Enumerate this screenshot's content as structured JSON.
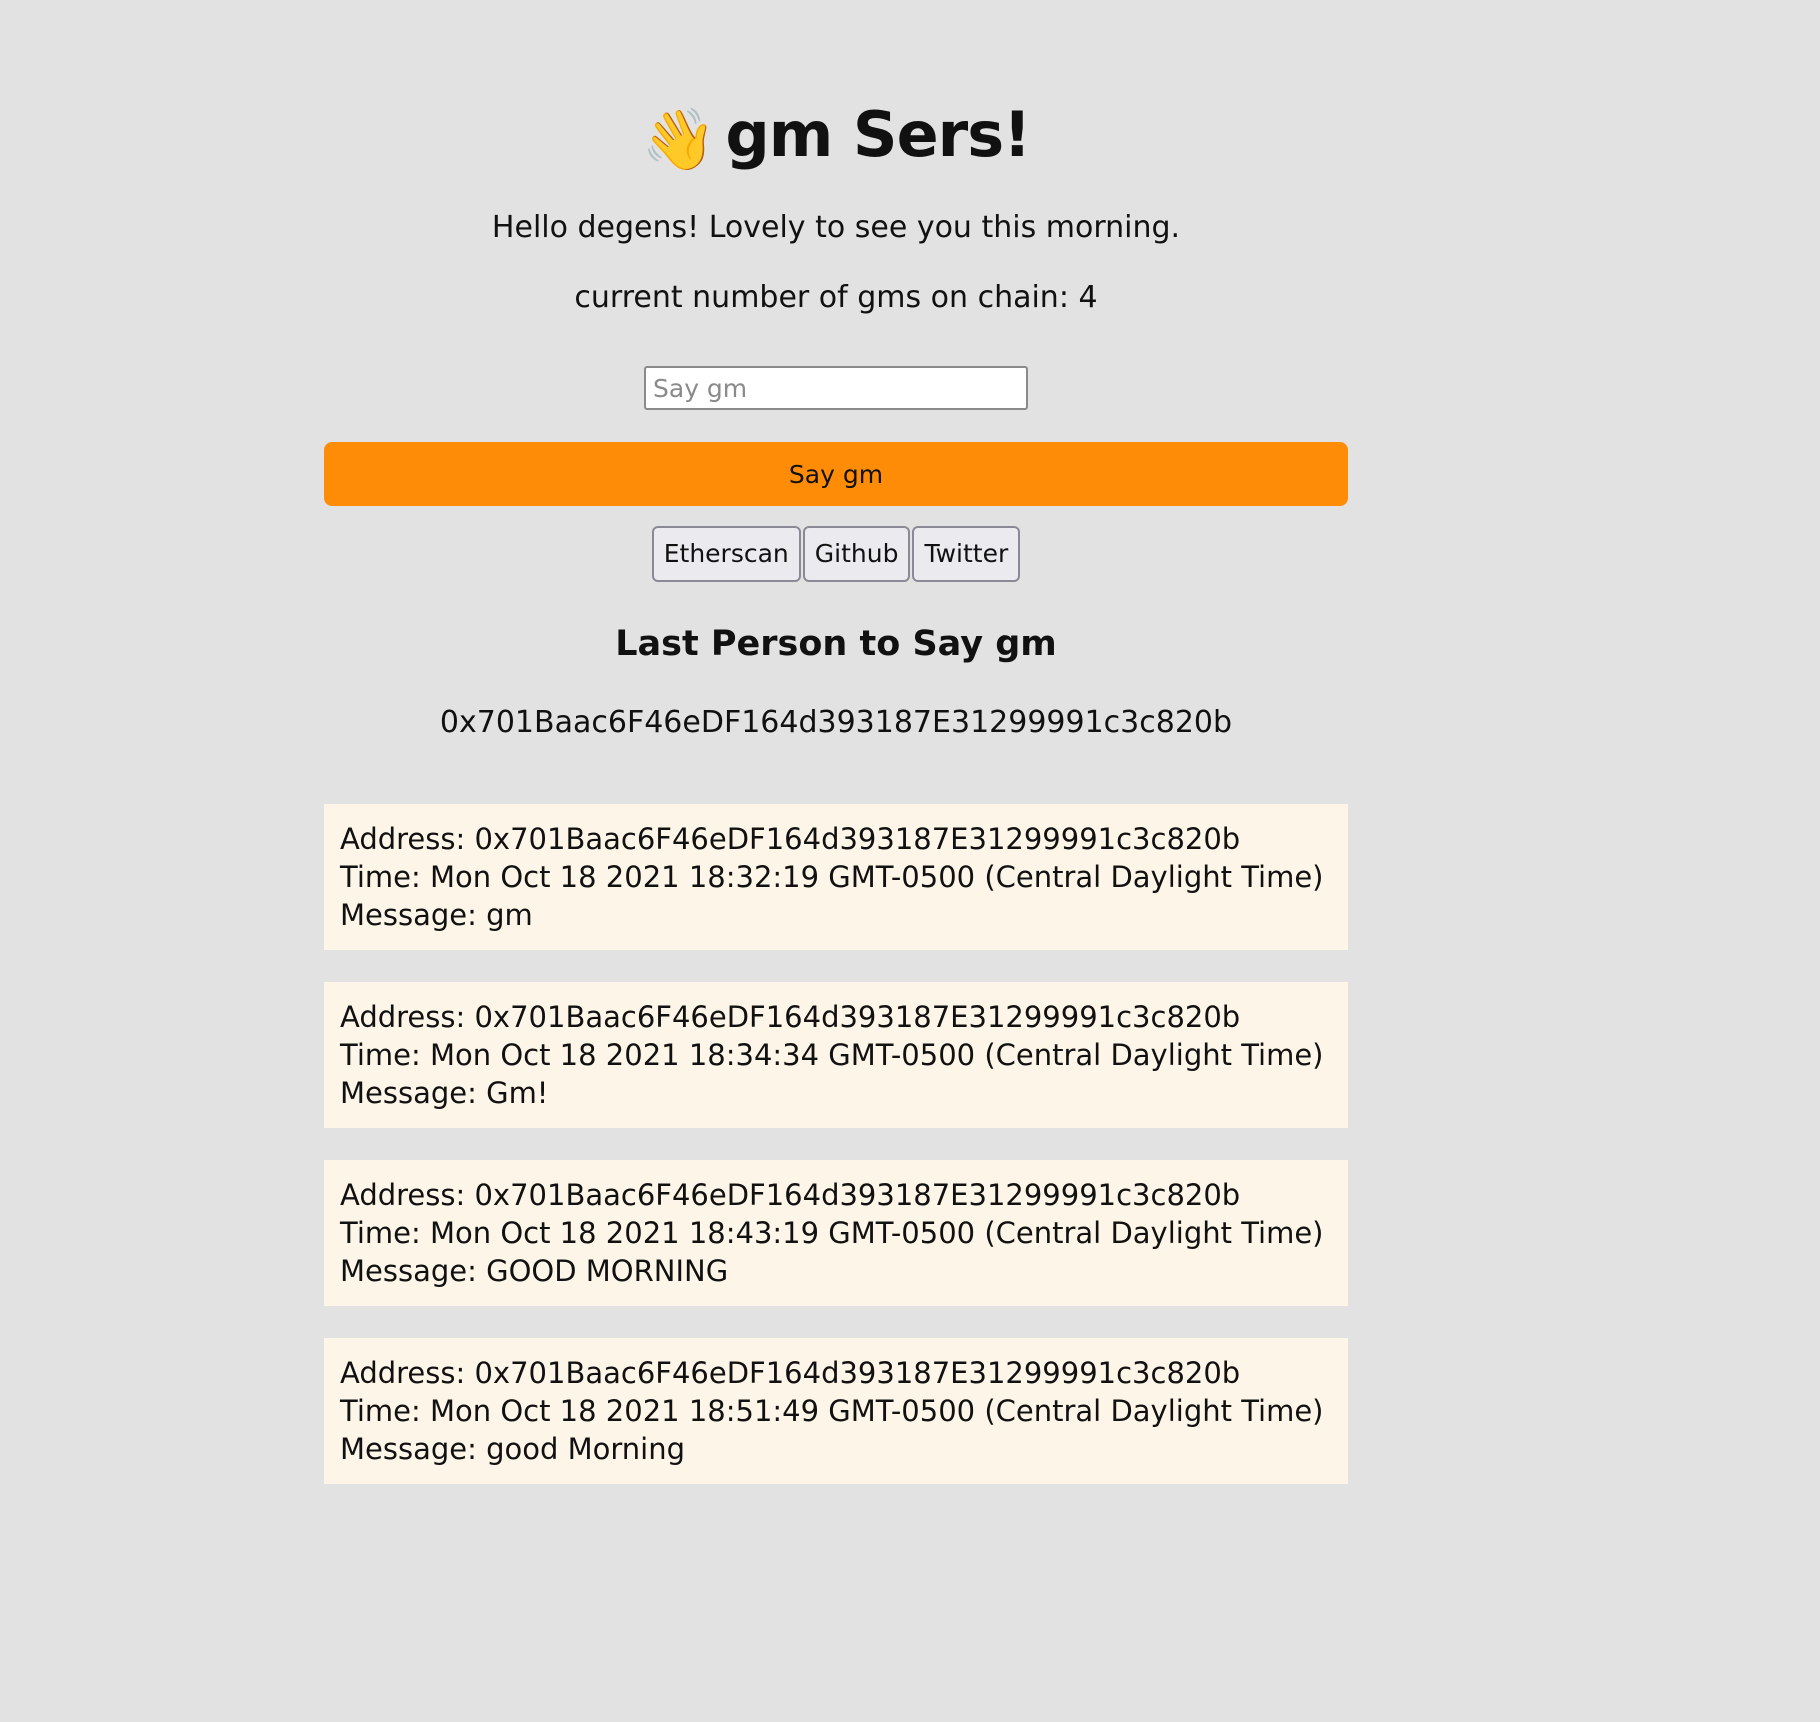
{
  "header": {
    "wave_icon": "👋",
    "title": "gm Sers!",
    "subtitle": "Hello degens! Lovely to see you this morning.",
    "count_label": "current number of gms on chain:",
    "count_value": "4"
  },
  "form": {
    "input_value": "",
    "input_placeholder": "Say gm",
    "submit_label": "Say gm",
    "submit_color": "#ff8c07"
  },
  "links": [
    {
      "label": "Etherscan"
    },
    {
      "label": "Github"
    },
    {
      "label": "Twitter"
    }
  ],
  "last_person": {
    "heading": "Last Person to Say gm",
    "address": "0x701Baac6F46eDF164d393187E31299991c3c820b"
  },
  "messages": [
    {
      "address_line": "Address: 0x701Baac6F46eDF164d393187E31299991c3c820b",
      "time_line": "Time: Mon Oct 18 2021 18:32:19 GMT-0500 (Central Daylight Time)",
      "message_line": "Message: gm"
    },
    {
      "address_line": "Address: 0x701Baac6F46eDF164d393187E31299991c3c820b",
      "time_line": "Time: Mon Oct 18 2021 18:34:34 GMT-0500 (Central Daylight Time)",
      "message_line": "Message: Gm!"
    },
    {
      "address_line": "Address: 0x701Baac6F46eDF164d393187E31299991c3c820b",
      "time_line": "Time: Mon Oct 18 2021 18:43:19 GMT-0500 (Central Daylight Time)",
      "message_line": "Message: GOOD MORNING"
    },
    {
      "address_line": "Address: 0x701Baac6F46eDF164d393187E31299991c3c820b",
      "time_line": "Time: Mon Oct 18 2021 18:51:49 GMT-0500 (Central Daylight Time)",
      "message_line": "Message: good Morning"
    }
  ],
  "colors": {
    "page_background": "#e2e2e2",
    "card_background": "#fdf6e8"
  }
}
